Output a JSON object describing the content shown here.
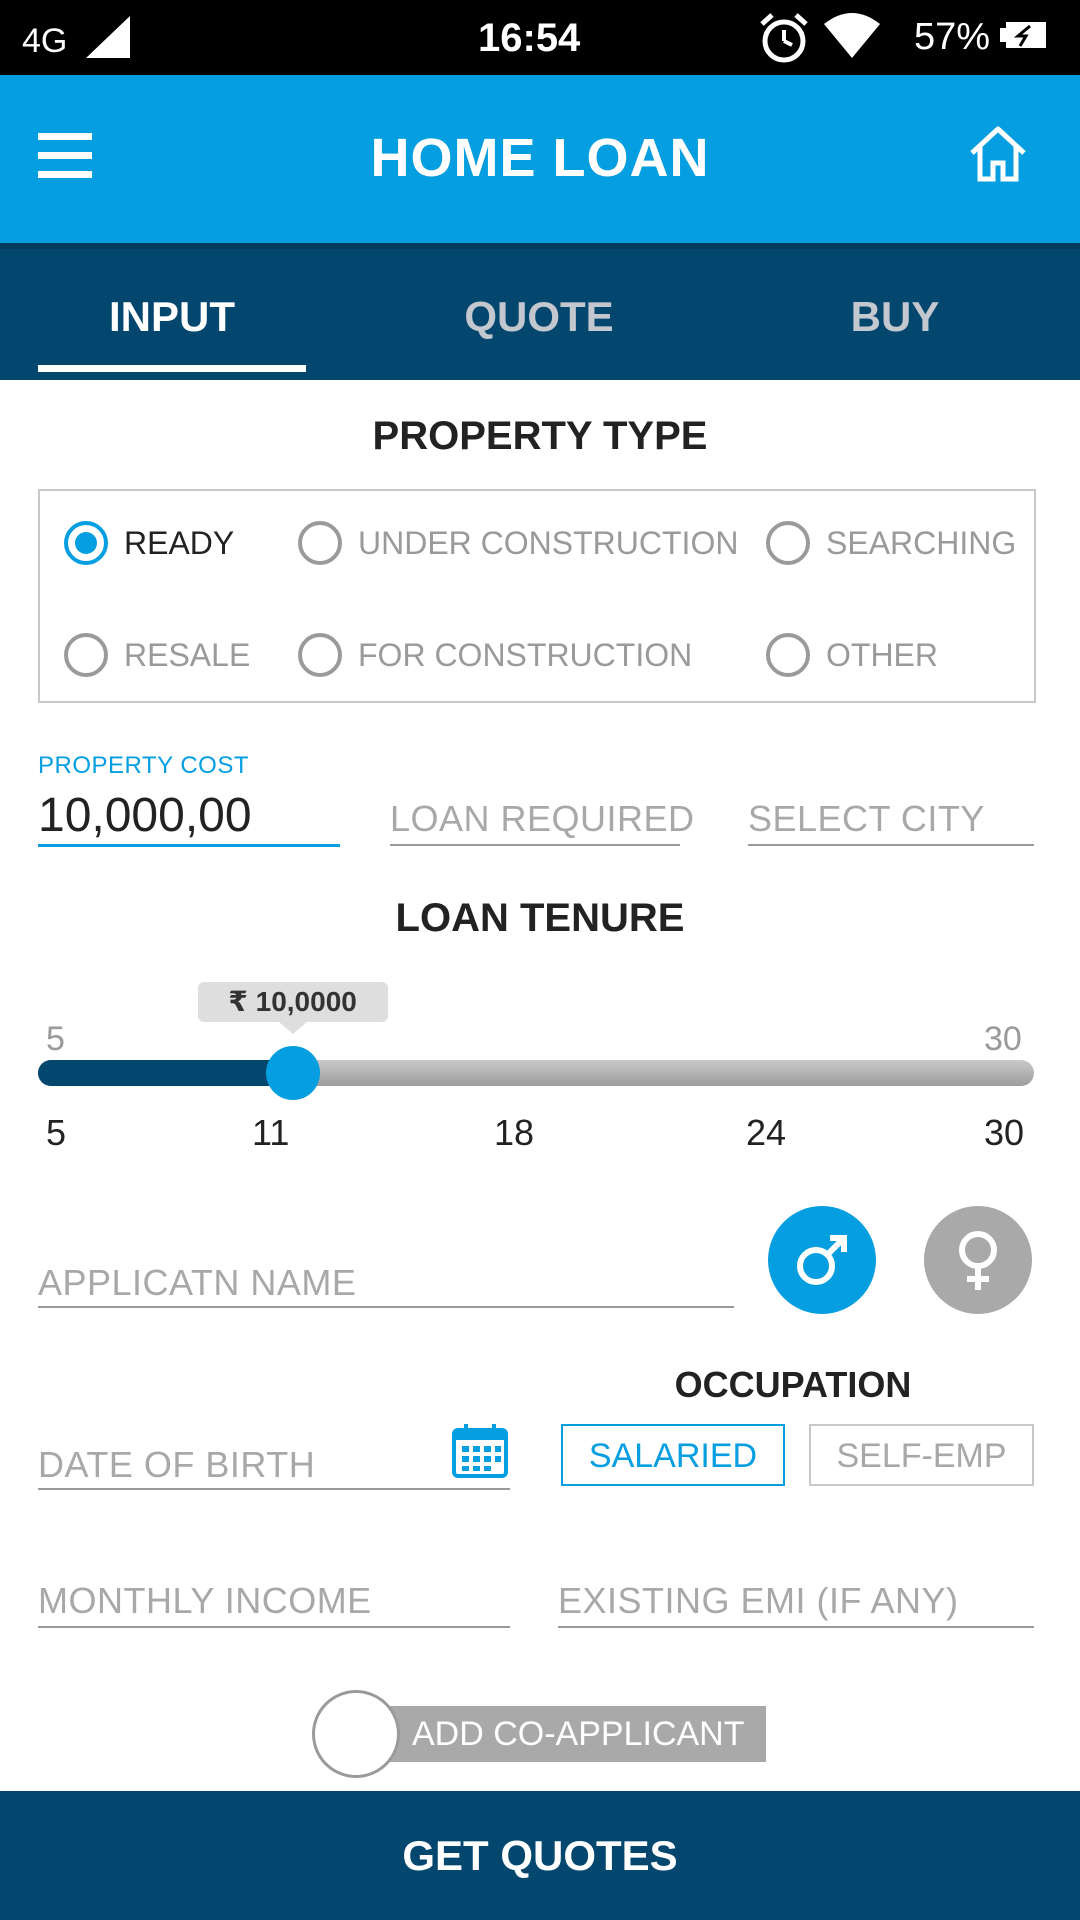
{
  "status_bar": {
    "network": "4G",
    "time": "16:54",
    "battery": "57%"
  },
  "app_bar": {
    "title": "HOME LOAN"
  },
  "tabs": [
    {
      "label": "INPUT",
      "active": true
    },
    {
      "label": "QUOTE",
      "active": false
    },
    {
      "label": "BUY",
      "active": false
    }
  ],
  "property_type": {
    "heading": "PROPERTY TYPE",
    "options": [
      "READY",
      "UNDER CONSTRUCTION",
      "SEARCHING",
      "RESALE",
      "FOR CONSTRUCTION",
      "OTHER"
    ],
    "selected": "READY"
  },
  "property_cost": {
    "label": "PROPERTY COST",
    "value": "10,000,00"
  },
  "loan_required": {
    "placeholder": "LOAN REQUIRED"
  },
  "select_city": {
    "placeholder": "SELECT CITY"
  },
  "loan_tenure": {
    "heading": "LOAN TENURE",
    "min_label": "5",
    "max_label": "30",
    "bubble": "₹ 10,0000",
    "min": 5,
    "max": 30,
    "value": 11,
    "ticks": [
      "5",
      "11",
      "18",
      "24",
      "30"
    ]
  },
  "applicant_name": {
    "placeholder": "APPLICATN NAME"
  },
  "gender": {
    "selected": "male"
  },
  "occupation": {
    "heading": "OCCUPATION",
    "options": [
      "SALARIED",
      "SELF-EMP"
    ],
    "selected": "SALARIED"
  },
  "date_of_birth": {
    "placeholder": "DATE OF BIRTH"
  },
  "monthly_income": {
    "placeholder": "MONTHLY INCOME"
  },
  "existing_emi": {
    "placeholder": "EXISTING EMI (IF ANY)"
  },
  "co_applicant": {
    "label": "ADD CO-APPLICANT",
    "on": false
  },
  "submit": {
    "label": "GET QUOTES"
  },
  "colors": {
    "primary": "#059ee0",
    "dark": "#03466e",
    "muted": "#9a9a9a"
  }
}
